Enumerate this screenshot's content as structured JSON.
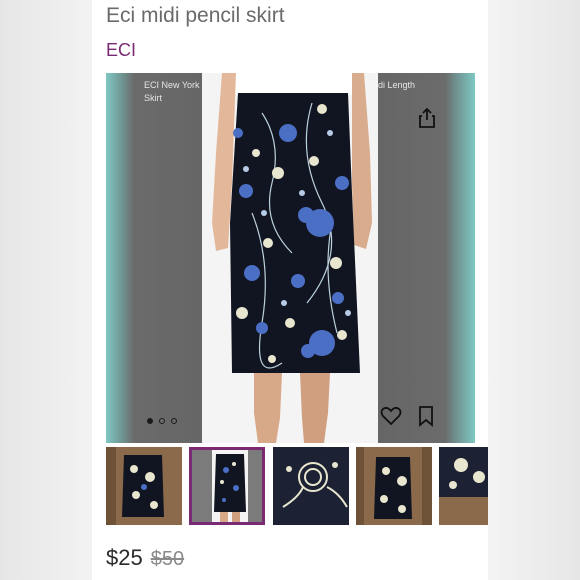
{
  "listing": {
    "title": "Eci midi pencil skirt",
    "brand": "ECI",
    "price": "$25",
    "original_price": "$50"
  },
  "main_image": {
    "underlay_text_left": "ECI New York Skirt",
    "underlay_text_right": "di Length",
    "carousel": {
      "total_dots": 3,
      "active_index": 0
    },
    "icons": {
      "share": "share-icon",
      "favorite": "heart-icon",
      "save": "bookmark-icon"
    }
  },
  "thumbnails": {
    "count": 5,
    "selected_index": 1
  },
  "colors": {
    "brand": "#7a2a72",
    "skirt": "#111522",
    "flower_blue": "#4b6fc4",
    "flower_cream": "#e9e6cf"
  }
}
